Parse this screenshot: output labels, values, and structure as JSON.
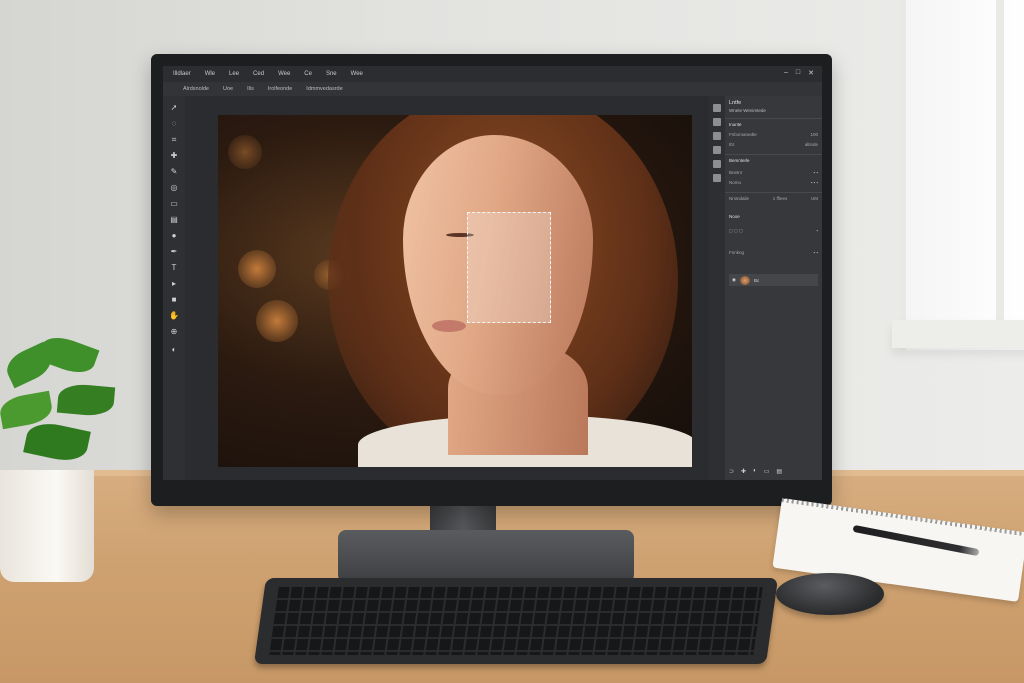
{
  "menubar": {
    "items": [
      "Illdlaer",
      "Wle",
      "Lee",
      "Ced",
      "Wee",
      "Ce",
      "Sne",
      "Wee"
    ],
    "controls": [
      "–",
      "□",
      "✕"
    ]
  },
  "optionsbar": {
    "items": [
      "Alrdsnolde",
      "Uoe",
      "Ilis",
      "Irolfeonde",
      "Idmmvedasrde"
    ]
  },
  "tools": [
    "arrow-icon",
    "lasso-icon",
    "crop-icon",
    "healing-icon",
    "brush-icon",
    "clone-icon",
    "eraser-icon",
    "gradient-icon",
    "dodge-icon",
    "pen-icon",
    "type-icon",
    "path-icon",
    "shape-icon",
    "hand-icon",
    "zoom-icon",
    "color-icon"
  ],
  "panels": {
    "title": "Lntfe",
    "subtitle": "Wnete   Wenimtede",
    "section1": "Inunte",
    "rows1": [
      [
        "Fnbomanedte",
        "100"
      ],
      [
        "Ibt",
        "altinde"
      ]
    ],
    "section2": "Bemnterle",
    "rows2": [
      [
        "Bnetnr",
        ""
      ],
      [
        "Nomu",
        ""
      ]
    ],
    "blend_mode": "Nnimdaile",
    "opacity_label": "1 fflees",
    "opacity_value": "UM",
    "section3": "Nooe",
    "rows3": [
      [
        "Fnnkng",
        ""
      ]
    ],
    "layer_name": "Bc"
  },
  "colors": {
    "accent": "#3a3b3e",
    "selection": "#f4f4f4"
  }
}
